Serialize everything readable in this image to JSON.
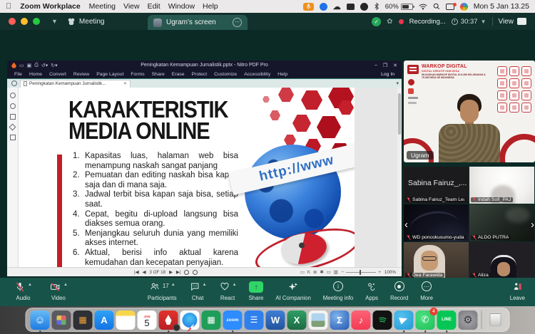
{
  "menubar": {
    "app": "Zoom Workplace",
    "menus": [
      "Meeting",
      "View",
      "Edit",
      "Window",
      "Help"
    ],
    "battery": "60%",
    "clock": "Mon 5 Jan 13.25"
  },
  "zoom_header": {
    "meeting_tab": "Meeting",
    "screen_tab": "Ugram's screen",
    "recording": "Recording...",
    "timer": "30:37",
    "view_label": "View"
  },
  "pdf": {
    "title": "Peningkatan Kemampuan Jurnalistik.pptx - Nitro PDF Pro",
    "menus": [
      "File",
      "Home",
      "Convert",
      "Review",
      "Page Layout",
      "Forms",
      "Share",
      "Erase",
      "Protect",
      "Customize",
      "Accessibility",
      "Help"
    ],
    "login": "Log In",
    "doc_tab": "Peningkatan Kemampuan Jurnalistik...",
    "page_indicator": "3 OF 18",
    "zoom_level": "100%"
  },
  "slide": {
    "title_line1": "KARAKTERISTIK",
    "title_line2": "MEDIA ONLINE",
    "items": [
      "Kapasitas luas, halaman web bisa menampung naskah sangat panjang",
      "Pemuatan dan editing naskah bisa kapan saja dan di mana saja.",
      "Jadwal terbit bisa kapan saja bisa, setiap saat.",
      "Cepat, begitu di-upload langsung bisa diakses semua orang.",
      "Menjangkau seluruh dunia yang memiliki akses internet.",
      "Aktual, berisi info aktual karena kemudahan dan kecepatan penyajian."
    ],
    "globe_banner": "http://www"
  },
  "speaker": {
    "name": "Ugram",
    "bg_title": "WARKOP DIGITAL",
    "bg_subtitle": "DIGITAL KREATIF HUB DESA",
    "bg_tagline": "WUJUDKAN WARKOP DIGITAL DI 8.496 KELURAHAN & 75.265 DESA SE INDONESIA"
  },
  "participants": [
    {
      "label": "Sabina Fairuz_Team Lea...",
      "display": "Sabina Fairuz_,..."
    },
    {
      "label": "Indah Sofi_PAJ"
    },
    {
      "label": "WD poncokusumo-yuda"
    },
    {
      "label": "ALDO PUTRA"
    },
    {
      "label": "Dea Farawida"
    },
    {
      "label": "Aliza"
    }
  ],
  "toolbar": {
    "audio": "Audio",
    "video": "Video",
    "participants": "Participants",
    "participants_count": "17",
    "chat": "Chat",
    "react": "React",
    "share": "Share",
    "ai": "AI Companion",
    "info": "Meeting info",
    "apps": "Apps",
    "record": "Record",
    "more": "More",
    "leave": "Leave"
  },
  "dock": {
    "calendar_month": "JAN",
    "calendar_day": "5",
    "whatsapp_badge": "4",
    "glyphs": {
      "appstore": "A",
      "zoom": "zoom",
      "word": "W",
      "excel": "X",
      "grapher": "Σ",
      "line": "LINE"
    }
  }
}
